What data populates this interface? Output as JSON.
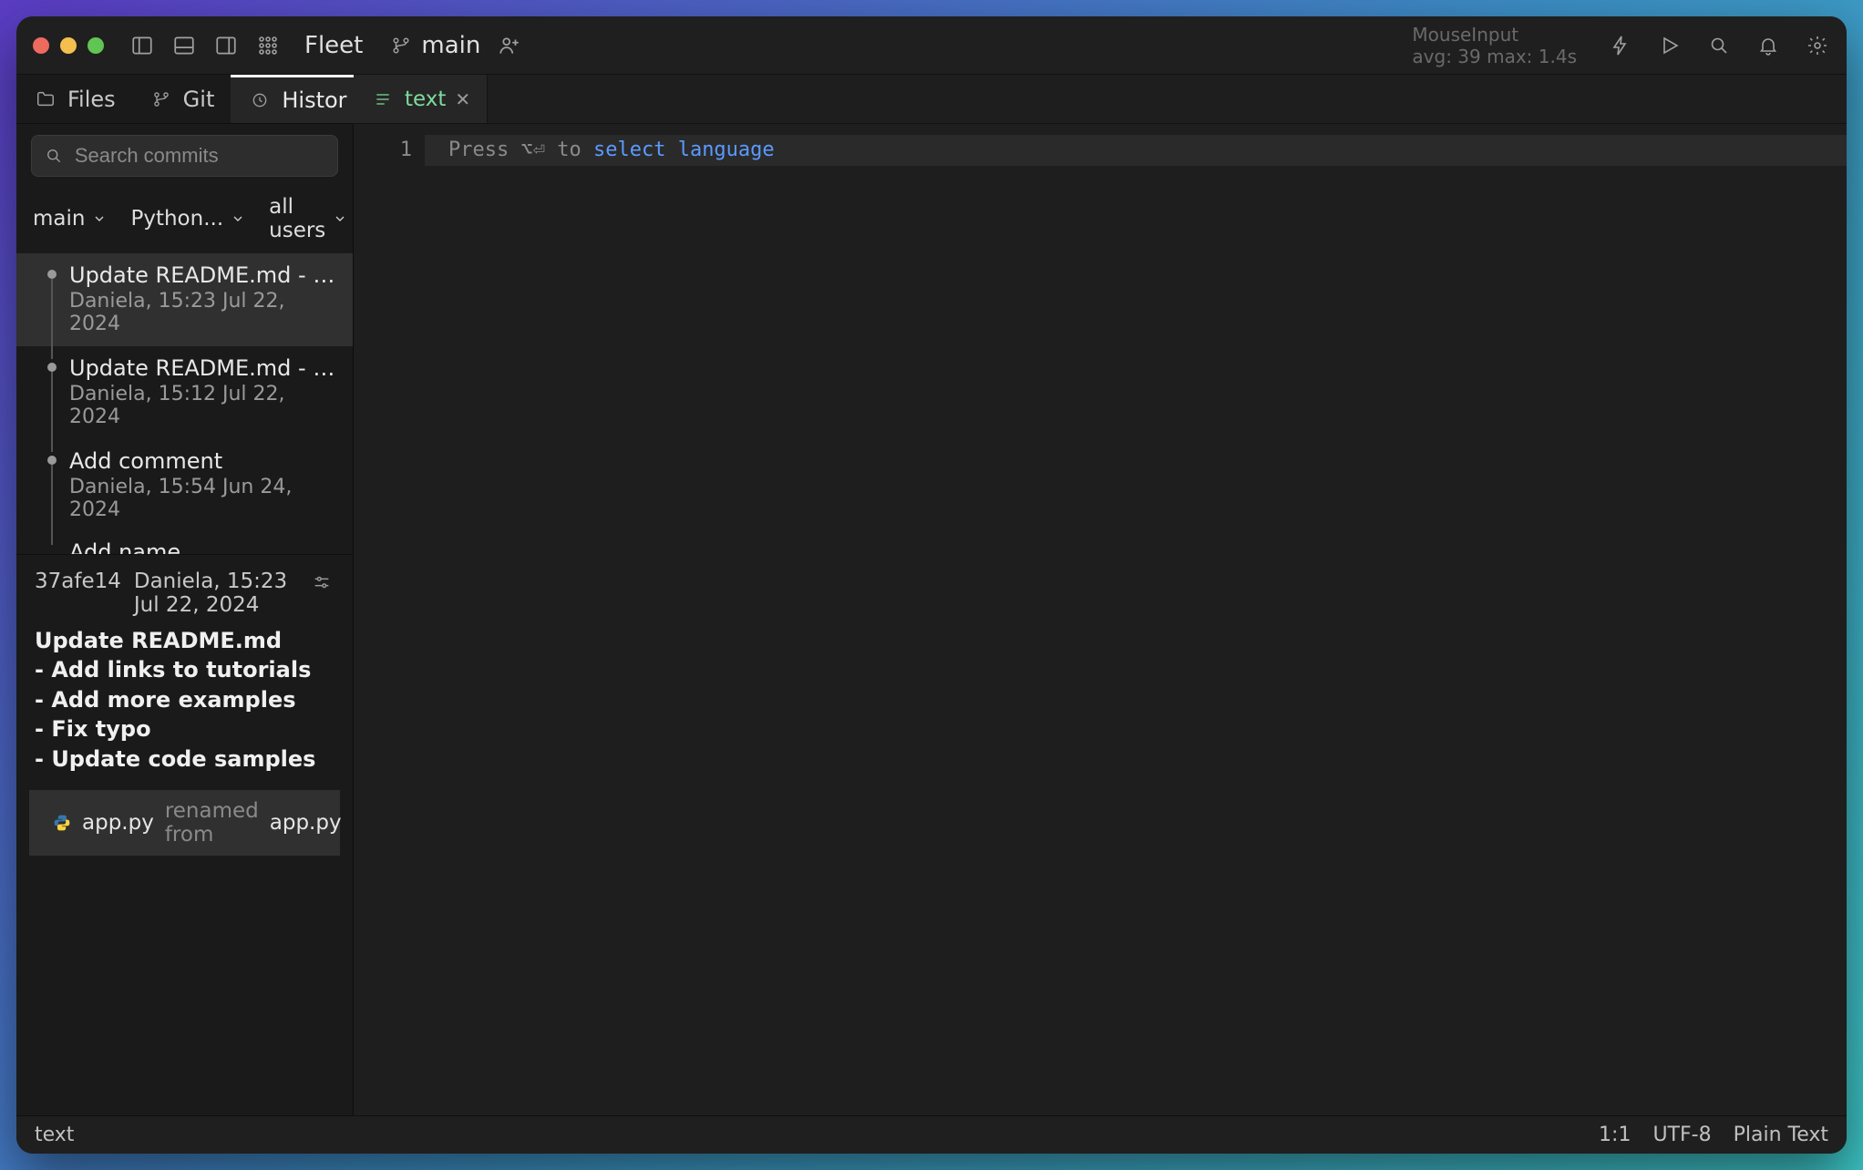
{
  "titlebar": {
    "project_name": "Fleet",
    "branch": "main",
    "status_line1": "MouseInput",
    "status_line2": "avg: 39 max: 1.4s"
  },
  "sidebar": {
    "tabs": [
      "Files",
      "Git",
      "Histor"
    ],
    "add_label": "+",
    "search_placeholder": "Search commits",
    "filters": {
      "branch": "main",
      "project": "Python...",
      "user": "all users"
    },
    "commits": [
      {
        "title": "Update README.md - Add link...",
        "meta": "Daniela, 15:23 Jul 22, 2024"
      },
      {
        "title": "Update README.md - Add link...",
        "meta": "Daniela, 15:12 Jul 22, 2024"
      },
      {
        "title": "Add comment",
        "meta": "Daniela, 15:54 Jun 24, 2024"
      }
    ],
    "commit_peek": "Add name",
    "detail": {
      "hash": "37afe14",
      "authorline": "Daniela, 15:23 Jul 22, 2024",
      "message_title": "Update README.md",
      "message_lines": [
        "- Add links to tutorials",
        "- Add more examples",
        "- Fix typo",
        "- Update code samples"
      ],
      "file_change": {
        "name": "app.py",
        "rename_text": "renamed from",
        "from": "app.py"
      }
    }
  },
  "editor": {
    "tab_label": "text",
    "line_number": "1",
    "hint_prefix": "Press",
    "hint_mid": "to",
    "hint_link": "select language",
    "shortcut_glyph": "⌥⏎"
  },
  "statusbar": {
    "left": "text",
    "pos": "1:1",
    "encoding": "UTF-8",
    "lang": "Plain Text"
  }
}
